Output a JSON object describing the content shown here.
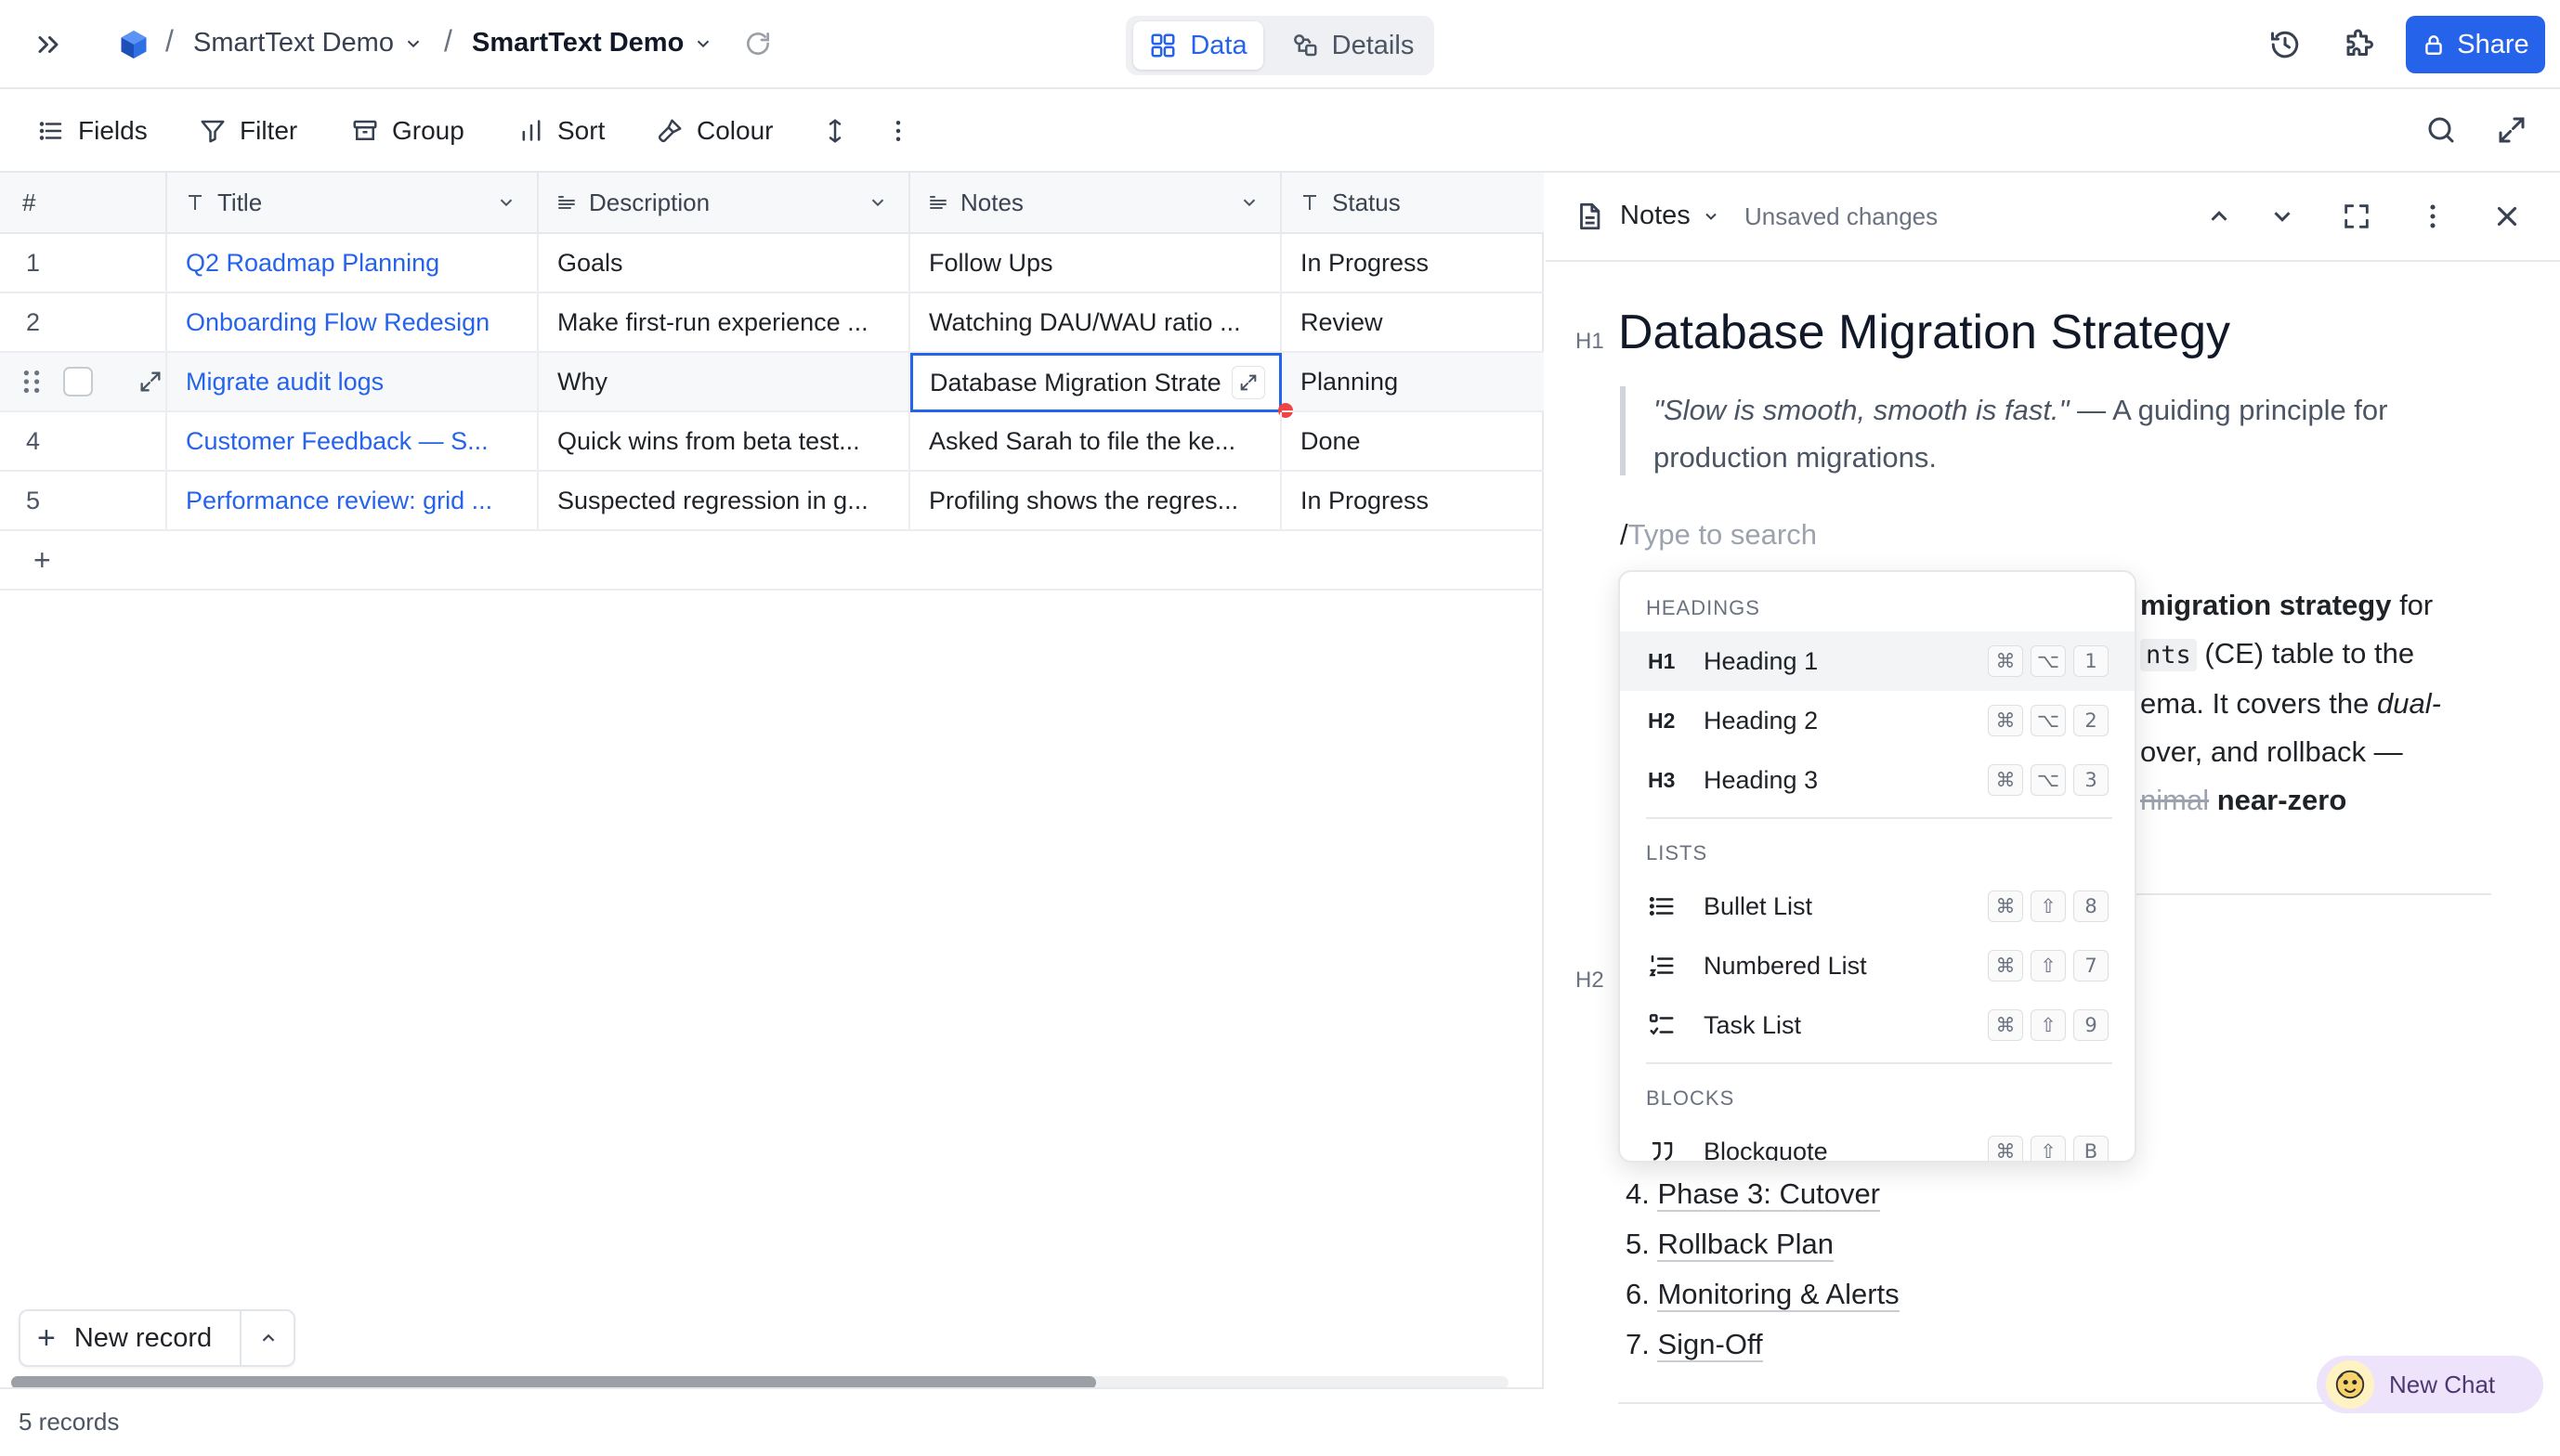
{
  "topbar": {
    "breadcrumb_1": "SmartText Demo",
    "breadcrumb_2": "SmartText Demo",
    "view_data": "Data",
    "view_details": "Details",
    "share": "Share",
    "accent": "#2563eb"
  },
  "toolbar": {
    "fields": "Fields",
    "filter": "Filter",
    "group": "Group",
    "sort": "Sort",
    "colour": "Colour"
  },
  "grid": {
    "columns": [
      "#",
      "Title",
      "Description",
      "Notes",
      "Status"
    ],
    "rows": [
      {
        "num": "1",
        "title": "Q2 Roadmap Planning",
        "description": "Goals",
        "notes": "Follow Ups",
        "status": "In Progress"
      },
      {
        "num": "2",
        "title": "Onboarding Flow Redesign",
        "description": "Make first-run experience ...",
        "notes": "Watching DAU/WAU ratio ...",
        "status": "Review"
      },
      {
        "num": "",
        "title": "Migrate audit logs",
        "description": "Why",
        "notes": "Database Migration Strate",
        "status": "Planning"
      },
      {
        "num": "4",
        "title": "Customer Feedback — S...",
        "description": "Quick wins from beta test...",
        "notes": "Asked Sarah to file the ke...",
        "status": "Done"
      },
      {
        "num": "5",
        "title": "Performance review: grid ...",
        "description": "Suspected regression in g...",
        "notes": "Profiling shows the regres...",
        "status": "In Progress"
      }
    ],
    "add_row": "+",
    "new_record": "New record",
    "record_count": "5 records"
  },
  "panel": {
    "field_name": "Notes",
    "save_state": "Unsaved changes",
    "h1_marker": "H1",
    "h2_marker": "H2",
    "doc_title": "Database Migration Strategy",
    "quote_em": "\"Slow is smooth, smooth is fast.\"",
    "quote_rest": " — A guiding principle for",
    "quote_line2": "production migrations.",
    "slash": "/",
    "search_placeholder": "Type to search",
    "body_frag_1a": "migration strategy",
    "body_frag_1b": " for",
    "body_frag_2a": "nts",
    "body_frag_2b": " (CE) table to the",
    "body_frag_3a": "ema. It covers the ",
    "body_frag_3b": "dual-",
    "body_frag_4": "over, and rollback —",
    "body_frag_5a": "nimal",
    "body_frag_5b": " near-zero",
    "outline": [
      {
        "n": "4.",
        "t": "Phase 3: Cutover"
      },
      {
        "n": "5.",
        "t": "Rollback Plan"
      },
      {
        "n": "6.",
        "t": "Monitoring & Alerts"
      },
      {
        "n": "7.",
        "t": "Sign-Off"
      }
    ],
    "new_chat": "New Chat"
  },
  "slash_menu": {
    "sec_headings": "HEADINGS",
    "sec_lists": "LISTS",
    "sec_blocks": "BLOCKS",
    "items": [
      {
        "label": "Heading 1",
        "glyph": "H1",
        "k3": "1"
      },
      {
        "label": "Heading 2",
        "glyph": "H2",
        "k3": "2"
      },
      {
        "label": "Heading 3",
        "glyph": "H3",
        "k3": "3"
      },
      {
        "label": "Bullet List",
        "k3": "8"
      },
      {
        "label": "Numbered List",
        "k3": "7"
      },
      {
        "label": "Task List",
        "k3": "9"
      },
      {
        "label": "Blockquote",
        "k3": "B"
      }
    ],
    "cmd": "⌘",
    "opt": "⌥",
    "shift": "⇧"
  }
}
